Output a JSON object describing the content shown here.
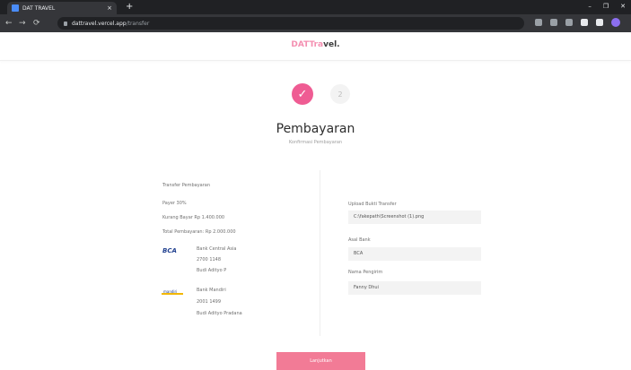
{
  "browser": {
    "tab_title": "DAT TRAVEL",
    "tab_close": "×",
    "new_tab": "+",
    "url_host": "dattravel.vercel.app",
    "url_path": "/transfer",
    "window_min": "–",
    "window_max": "❐",
    "window_close": "✕"
  },
  "header": {
    "brand_part1": "DATTra",
    "brand_part2": "vel."
  },
  "stepper": {
    "step1_icon": "check-icon",
    "step2_label": "2"
  },
  "page": {
    "title": "Pembayaran",
    "subtitle": "Konfirmasi Pembayaran"
  },
  "payment_info": {
    "heading": "Transfer Pembayaran",
    "dp_label": "Payer 30%",
    "remaining_label": "Kurang Bayar Rp 1.400.000",
    "total_label": "Total Pembayaran: Rp 2.000.000",
    "banks": [
      {
        "logo": "BCA",
        "name": "Bank Central Asia",
        "account": "2700 1148",
        "holder": "Budi Adityo P"
      },
      {
        "logo": "mandiri",
        "name": "Bank Mandiri",
        "account": "2001 1499",
        "holder": "Budi Adityo Pradana"
      }
    ]
  },
  "form": {
    "upload_label": "Upload Bukti Transfer",
    "upload_value": "C:\\fakepath\\Screenshot (1).png",
    "bank_label": "Asal Bank",
    "bank_value": "BCA",
    "sender_label": "Nama Pengirim",
    "sender_value": "Fanny Dhui"
  },
  "actions": {
    "submit_label": "Lanjutkan"
  },
  "colors": {
    "accent": "#ef5c93",
    "button": "#f27b96"
  }
}
